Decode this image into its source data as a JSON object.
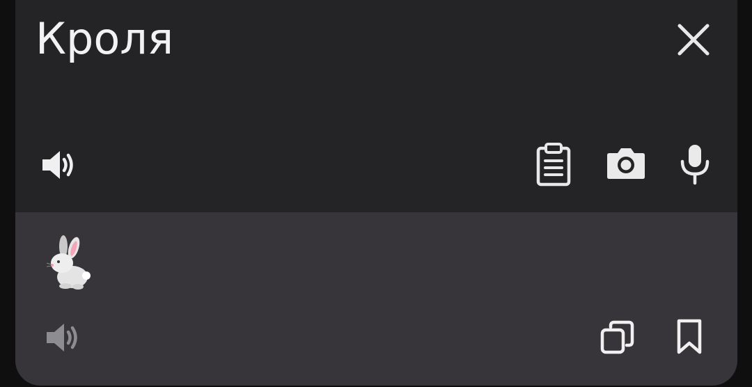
{
  "source": {
    "text": "Кроля",
    "icons": [
      "close-icon",
      "speaker-icon",
      "clipboard-icon",
      "camera-icon",
      "microphone-icon"
    ]
  },
  "result": {
    "text": "🐇",
    "icons": [
      "speaker-icon",
      "copy-icon",
      "bookmark-icon"
    ]
  },
  "colors": {
    "source_bg": "#242426",
    "result_bg": "#373539",
    "icon_primary": "#e8e8e8",
    "icon_muted": "#8d8c90"
  }
}
